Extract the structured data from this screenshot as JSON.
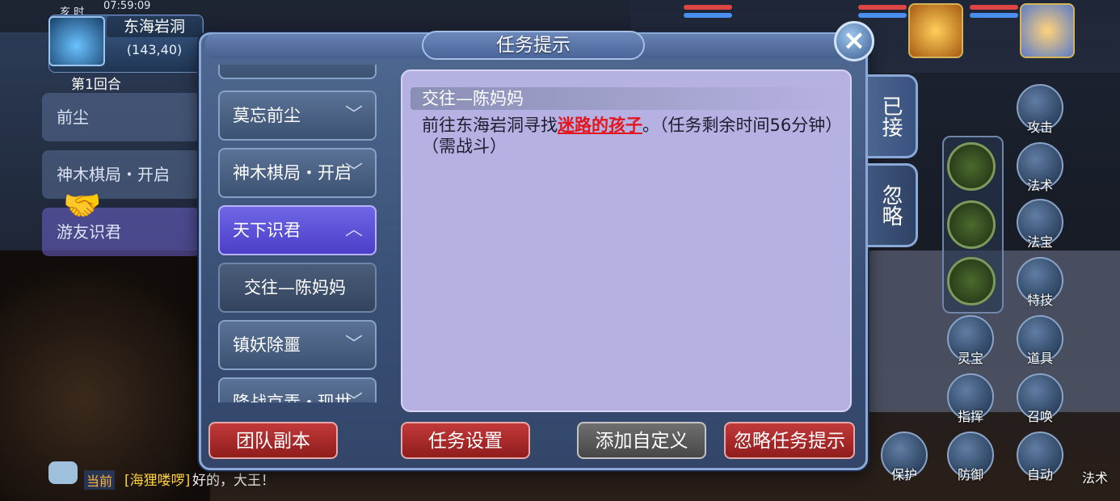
{
  "status_bar": {
    "time_period": "亥 时",
    "clock": "07:59:09"
  },
  "map": {
    "name": "东海岩洞",
    "coords": "(143,40)"
  },
  "battle": {
    "round": "第1回合"
  },
  "background_tabs": [
    "前尘",
    "神木棋局・开启",
    "游友识君"
  ],
  "dialog": {
    "title": "任务提示",
    "close_label": "×",
    "task_list": [
      {
        "label": "莫忘前尘",
        "type": "category",
        "expanded": false
      },
      {
        "label": "神木棋局・开启",
        "type": "category",
        "expanded": false
      },
      {
        "label": "天下识君",
        "type": "category",
        "expanded": true,
        "active": true
      },
      {
        "label": "交往—陈妈妈",
        "type": "task"
      },
      {
        "label": "镇妖除噩",
        "type": "category",
        "expanded": false
      },
      {
        "label": "降战京弄・现世",
        "type": "category",
        "expanded": false
      }
    ],
    "detail": {
      "task_name": "交往—陈妈妈",
      "text_before": "前往东海岩洞寻找",
      "npc": "迷路的孩子",
      "text_after": "。（任务剩余时间56分钟）（需战斗）"
    },
    "side_tabs": {
      "accepted": "已接",
      "ignored": "忽略"
    },
    "buttons": {
      "team_dungeon": "团队副本",
      "task_settings": "任务设置",
      "add_custom": "添加自定义",
      "ignore_hint": "忽略任务提示"
    }
  },
  "skills": [
    "攻击",
    "法术",
    "法宝",
    "特技",
    "道具",
    "灵宝",
    "指挥",
    "召唤",
    "保护",
    "防御",
    "自动",
    "法术"
  ],
  "chat": {
    "channel": "当前",
    "speaker": "[海狸喽啰]",
    "message": "好的，大王！"
  },
  "colors": {
    "task_link": "#e2161c",
    "dialog_bg": "#394f74",
    "detail_bg": "#b5b1e3",
    "active_tab": "#4b3fc8",
    "button_red": "#8f1c1c"
  }
}
